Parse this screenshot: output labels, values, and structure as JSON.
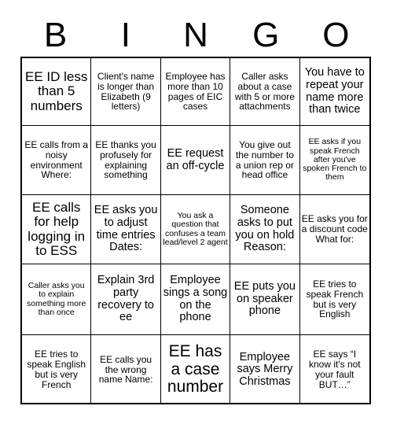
{
  "header": {
    "letters": [
      "B",
      "I",
      "N",
      "G",
      "O"
    ]
  },
  "grid": {
    "columns": 5,
    "rows": 5,
    "cells": [
      {
        "text": "EE ID less than 5 numbers",
        "size": "lg"
      },
      {
        "text": "Client's name is longer than Elizabeth (9 letters)",
        "size": "sm"
      },
      {
        "text": "Employee has more than 10 pages of EIC cases",
        "size": "sm"
      },
      {
        "text": "Caller asks about a case with 5 or more attachments",
        "size": "sm"
      },
      {
        "text": "You have to repeat your name more than twice",
        "size": "md"
      },
      {
        "text": "EE calls from a noisy environment Where:",
        "size": "sm"
      },
      {
        "text": "EE thanks you profusely for explaining something",
        "size": "sm"
      },
      {
        "text": "EE request an off-cycle",
        "size": "md"
      },
      {
        "text": "You give out the number to a union rep or head office",
        "size": "sm"
      },
      {
        "text": "EE asks if you speak French after you've spoken French to them",
        "size": "xs"
      },
      {
        "text": "EE calls for help logging in to ESS",
        "size": "lg"
      },
      {
        "text": "EE asks you to adjust time entries Dates:",
        "size": "md"
      },
      {
        "text": "You ask a question that confuses a team lead/level 2 agent",
        "size": "xs"
      },
      {
        "text": "Someone asks to put you on hold Reason:",
        "size": "md"
      },
      {
        "text": "EE asks you for a discount code What for:",
        "size": "sm"
      },
      {
        "text": "Caller asks you to explain something more than once",
        "size": "xs"
      },
      {
        "text": "Explain 3rd party recovery to ee",
        "size": "md"
      },
      {
        "text": "Employee sings a song on the phone",
        "size": "md"
      },
      {
        "text": "EE puts you on speaker phone",
        "size": "md"
      },
      {
        "text": "EE tries to speak French but is very English",
        "size": "sm"
      },
      {
        "text": "EE tries to speak English but is very French",
        "size": "sm"
      },
      {
        "text": "EE calls you the wrong name Name:",
        "size": "sm"
      },
      {
        "text": "EE has a case number",
        "size": "xl"
      },
      {
        "text": "Employee says Merry Christmas",
        "size": "md"
      },
      {
        "text": "EE says “I know it's not your fault BUT…”",
        "size": "sm"
      }
    ]
  }
}
